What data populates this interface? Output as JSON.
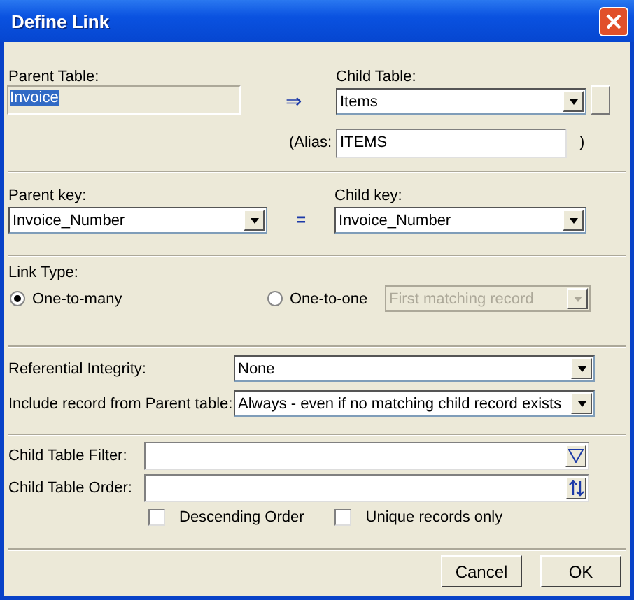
{
  "window": {
    "title": "Define Link"
  },
  "parent_table": {
    "label": "Parent Table:",
    "value": "Invoice",
    "highlighted": true
  },
  "link_arrow": "⇒",
  "child_table": {
    "label": "Child Table:",
    "value": "Items"
  },
  "alias": {
    "label": "(Alias:",
    "value": "ITEMS",
    "closing": ")"
  },
  "parent_key": {
    "label": "Parent key:",
    "value": "Invoice_Number"
  },
  "equals": "=",
  "child_key": {
    "label": "Child key:",
    "value": "Invoice_Number"
  },
  "link_type": {
    "label": "Link Type:",
    "options": [
      {
        "label": "One-to-many",
        "selected": true
      },
      {
        "label": "One-to-one",
        "selected": false
      }
    ],
    "match": {
      "value": "First matching record",
      "disabled": true
    }
  },
  "referential_integrity": {
    "label": "Referential Integrity:",
    "value": "None"
  },
  "include_record": {
    "label": "Include record from Parent table:",
    "value": "Always - even if no matching child record exists"
  },
  "child_filter": {
    "label": "Child Table Filter:"
  },
  "child_order": {
    "label": "Child Table Order:"
  },
  "checkboxes": [
    {
      "label": "Descending Order",
      "checked": false
    },
    {
      "label": "Unique records only",
      "checked": false
    }
  ],
  "buttons": [
    "Cancel",
    "OK"
  ]
}
